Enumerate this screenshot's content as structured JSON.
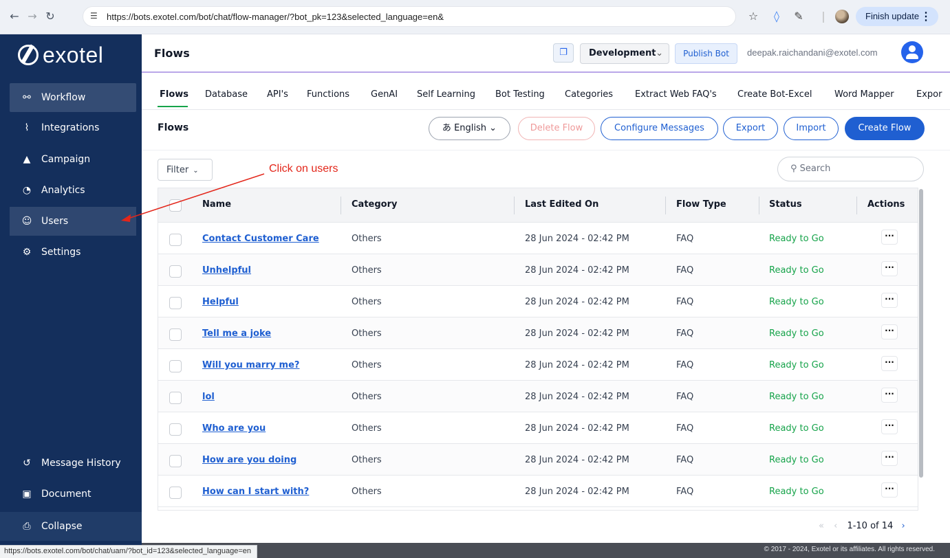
{
  "browser": {
    "url": "https://bots.exotel.com/bot/chat/flow-manager/?bot_pk=123&selected_language=en&",
    "finish_update": "Finish update",
    "status_url": "https://bots.exotel.com/bot/chat/uam/?bot_id=123&selected_language=en"
  },
  "sidebar": {
    "logo": "exotel",
    "items": [
      {
        "label": "Workflow",
        "icon": "workflow-icon"
      },
      {
        "label": "Integrations",
        "icon": "integrations-icon"
      },
      {
        "label": "Campaign",
        "icon": "campaign-icon"
      },
      {
        "label": "Analytics",
        "icon": "analytics-icon"
      },
      {
        "label": "Users",
        "icon": "users-icon"
      },
      {
        "label": "Settings",
        "icon": "settings-icon"
      }
    ],
    "bottom_items": [
      {
        "label": "Message History",
        "icon": "history-icon"
      },
      {
        "label": "Document",
        "icon": "document-icon"
      },
      {
        "label": "Collapse",
        "icon": "collapse-icon"
      }
    ]
  },
  "header": {
    "title": "Flows",
    "environment": "Development",
    "publish_label": "Publish Bot",
    "user_email": "deepak.raichandani@exotel.com"
  },
  "tabs": [
    "Flows",
    "Database",
    "API's",
    "Functions",
    "GenAI",
    "Self Learning",
    "Bot Testing",
    "Categories",
    "Extract Web FAQ's",
    "Create Bot-Excel",
    "Word Mapper",
    "Expor"
  ],
  "toolbar": {
    "title": "Flows",
    "language": "English",
    "delete_label": "Delete Flow",
    "configure_label": "Configure Messages",
    "export_label": "Export",
    "import_label": "Import",
    "create_label": "Create Flow"
  },
  "filter_label": "Filter",
  "search_placeholder": "Search",
  "annotation": {
    "text": "Click on users",
    "color": "#e3261a"
  },
  "table": {
    "columns": [
      "Name",
      "Category",
      "Last Edited On",
      "Flow Type",
      "Status",
      "Actions"
    ],
    "rows": [
      {
        "name": "Contact Customer Care",
        "category": "Others",
        "edited": "28 Jun 2024 - 02:42 PM",
        "type": "FAQ",
        "status": "Ready to Go"
      },
      {
        "name": "Unhelpful",
        "category": "Others",
        "edited": "28 Jun 2024 - 02:42 PM",
        "type": "FAQ",
        "status": "Ready to Go"
      },
      {
        "name": "Helpful",
        "category": "Others",
        "edited": "28 Jun 2024 - 02:42 PM",
        "type": "FAQ",
        "status": "Ready to Go"
      },
      {
        "name": "Tell me a joke",
        "category": "Others",
        "edited": "28 Jun 2024 - 02:42 PM",
        "type": "FAQ",
        "status": "Ready to Go"
      },
      {
        "name": "Will you marry me?",
        "category": "Others",
        "edited": "28 Jun 2024 - 02:42 PM",
        "type": "FAQ",
        "status": "Ready to Go"
      },
      {
        "name": "lol",
        "category": "Others",
        "edited": "28 Jun 2024 - 02:42 PM",
        "type": "FAQ",
        "status": "Ready to Go"
      },
      {
        "name": "Who are you",
        "category": "Others",
        "edited": "28 Jun 2024 - 02:42 PM",
        "type": "FAQ",
        "status": "Ready to Go"
      },
      {
        "name": "How are you doing",
        "category": "Others",
        "edited": "28 Jun 2024 - 02:42 PM",
        "type": "FAQ",
        "status": "Ready to Go"
      },
      {
        "name": "How can I start with?",
        "category": "Others",
        "edited": "28 Jun 2024 - 02:42 PM",
        "type": "FAQ",
        "status": "Ready to Go"
      }
    ],
    "more_label": "···"
  },
  "pagination": {
    "range": "1-10 of 14"
  },
  "footer": {
    "copyright": "© 2017 - 2024, Exotel or its affiliates. All rights reserved."
  }
}
